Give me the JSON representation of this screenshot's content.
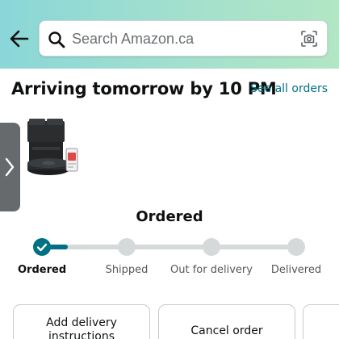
{
  "header": {
    "search_placeholder": "Search Amazon.ca",
    "colors": {
      "gradient_start": "#8ad6d8",
      "gradient_end": "#b2e6c4"
    }
  },
  "delivery": {
    "headline": "Arriving tomorrow by 10 PM",
    "see_all_label": "See all orders"
  },
  "status": {
    "title": "Ordered",
    "progress_fraction": 0.1,
    "steps": [
      {
        "label": "Ordered",
        "state": "done"
      },
      {
        "label": "Shipped",
        "state": "pending"
      },
      {
        "label": "Out for delivery",
        "state": "pending"
      },
      {
        "label": "Delivered",
        "state": "pending"
      }
    ]
  },
  "actions": [
    {
      "label": "Add delivery instructions"
    },
    {
      "label": "Cancel order"
    },
    {
      "label": ""
    }
  ],
  "icons": {
    "back": "arrow-left-icon",
    "search": "search-icon",
    "camera": "camera-scan-icon",
    "side_tab": "chevron-right-icon",
    "check": "check-icon"
  },
  "colors": {
    "accent": "#007185",
    "inactive": "#d5d9d9"
  }
}
